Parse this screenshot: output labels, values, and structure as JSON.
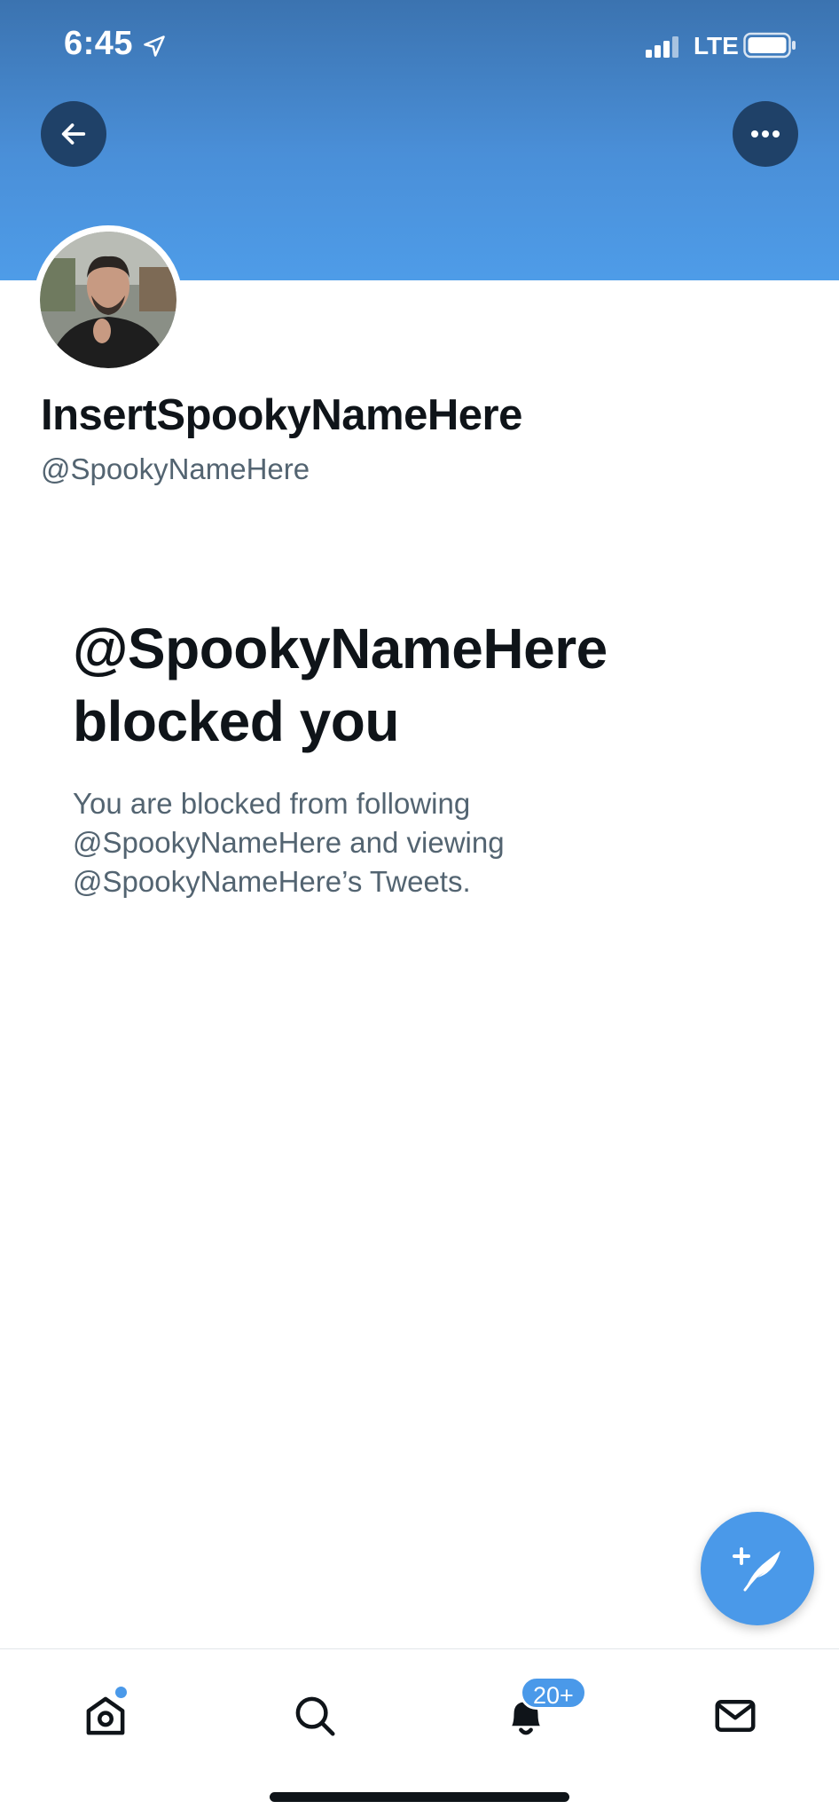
{
  "status_bar": {
    "time": "6:45",
    "network": "LTE",
    "icons": [
      "location-arrow-icon",
      "signal-icon",
      "battery-icon"
    ]
  },
  "header": {
    "banner_color": "#4a8fd8",
    "back_icon": "arrow-left-icon",
    "more_icon": "more-horizontal-icon"
  },
  "profile": {
    "display_name": "InsertSpookyNameHere",
    "handle": "@SpookyNameHere"
  },
  "blocked": {
    "title_line1": "@SpookyNameHere",
    "title_line2": "blocked you",
    "desc_line1": "You are blocked from following",
    "desc_line2": "@SpookyNameHere and viewing",
    "desc_line3": "@SpookyNameHere’s Tweets."
  },
  "fab": {
    "icon": "compose-tweet-icon",
    "color": "#4a99e9"
  },
  "tab_bar": {
    "tabs": [
      {
        "name": "home",
        "icon": "home-icon",
        "has_dot": true
      },
      {
        "name": "search",
        "icon": "search-icon"
      },
      {
        "name": "notifications",
        "icon": "bell-icon",
        "badge": "20+"
      },
      {
        "name": "messages",
        "icon": "mail-icon"
      }
    ]
  },
  "colors": {
    "accent": "#4a99e9",
    "text_primary": "#0f1419",
    "text_secondary": "#536471"
  }
}
